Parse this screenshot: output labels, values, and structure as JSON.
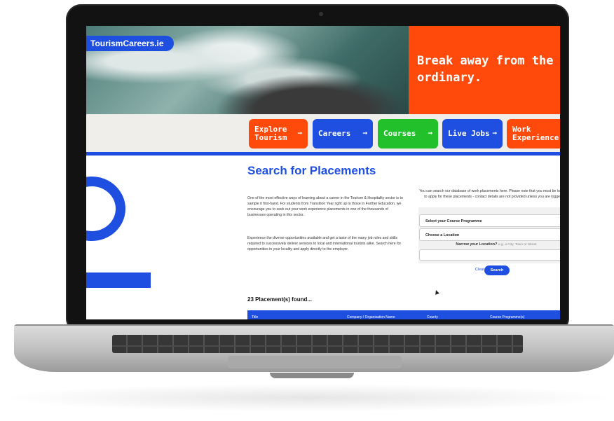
{
  "site": {
    "logo": "TourismCareers.ie",
    "tagline": "Break away from the ordinary."
  },
  "nav": [
    {
      "label": "Explore Tourism",
      "color": "#ff4a0c"
    },
    {
      "label": "Careers",
      "color": "#1f4fe0"
    },
    {
      "label": "Courses",
      "color": "#22c12b"
    },
    {
      "label": "Live Jobs",
      "color": "#1f4fe0"
    },
    {
      "label": "Work Experience",
      "color": "#ff4a0c"
    }
  ],
  "nav_arrow": "→",
  "page": {
    "title": "Search for Placements",
    "intro_1": "One of the most effective ways of learning about a career in the Tourism & Hospitality sector is to sample it first-hand. For students from Transition Year right up to those in Further Education, we encourage you to seek out your work experience placements in one of the thousands of businesses operating in this sector.",
    "intro_2": "Experience the diverse opportunities available and get a taste of the many job roles and skills required to successively deliver services to local and international tourists alike. Search here for opportunities in your locality and apply directly to the employer.",
    "right_note": "You can search our database of work placements here. Please note that you must be logged in to apply for these placements - contact details are not provided unless you are logged in."
  },
  "form": {
    "course_select": "Select your Course Programme",
    "location_select": "Choose a Location",
    "narrow_label": "Narrow your Location?",
    "narrow_hint": "e.g. a City, Town or Street",
    "clear_label": "Clear",
    "search_label": "Search"
  },
  "results": {
    "count_text": "23 Placement(s) found...",
    "columns": [
      "Title",
      "Company / Organisation Name",
      "County",
      "Course Programme(s)"
    ]
  }
}
